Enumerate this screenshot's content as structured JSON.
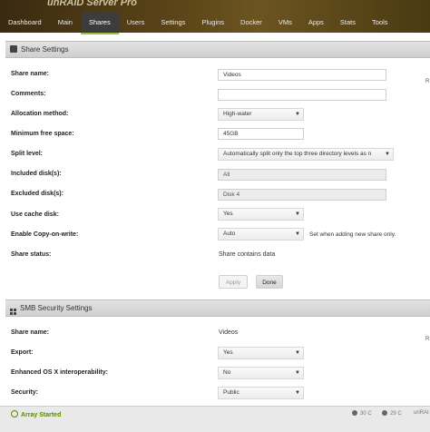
{
  "header": {
    "brand": "unRAID Server Pro",
    "nav": [
      "Dashboard",
      "Main",
      "Shares",
      "Users",
      "Settings",
      "Plugins",
      "Docker",
      "VMs",
      "Apps",
      "Stats",
      "Tools"
    ],
    "active_tab": "Shares"
  },
  "share_settings": {
    "title": "Share Settings",
    "fields": {
      "share_name": {
        "label": "Share name:",
        "value": "Videos"
      },
      "comments": {
        "label": "Comments:",
        "value": ""
      },
      "allocation_method": {
        "label": "Allocation method:",
        "value": "High-water"
      },
      "min_free_space": {
        "label": "Minimum free space:",
        "value": "45GB"
      },
      "split_level": {
        "label": "Split level:",
        "value": "Automatically split only the top three directory levels as n"
      },
      "included_disks": {
        "label": "Included disk(s):",
        "value": "All"
      },
      "excluded_disks": {
        "label": "Excluded disk(s):",
        "value": "Disk 4"
      },
      "use_cache_disk": {
        "label": "Use cache disk:",
        "value": "Yes"
      },
      "copy_on_write": {
        "label": "Enable Copy-on-write:",
        "value": "Auto",
        "note": "Set when adding new share only."
      },
      "share_status": {
        "label": "Share status:",
        "value": "Share contains data"
      }
    },
    "apply_label": "Apply",
    "done_label": "Done",
    "edge_marker": "R"
  },
  "smb_settings": {
    "title": "SMB Security Settings",
    "fields": {
      "share_name": {
        "label": "Share name:",
        "value": "Videos"
      },
      "export": {
        "label": "Export:",
        "value": "Yes"
      },
      "osx": {
        "label": "Enhanced OS X interoperability:",
        "value": "No"
      },
      "security": {
        "label": "Security:",
        "value": "Public"
      }
    },
    "edge_marker": "R"
  },
  "footer": {
    "status": "Array Started",
    "temp1": "30 C",
    "temp2": "29 C",
    "right_text": "unRAI"
  },
  "colors": {
    "accent": "#9cc33a",
    "status_green": "#5f8a00"
  }
}
